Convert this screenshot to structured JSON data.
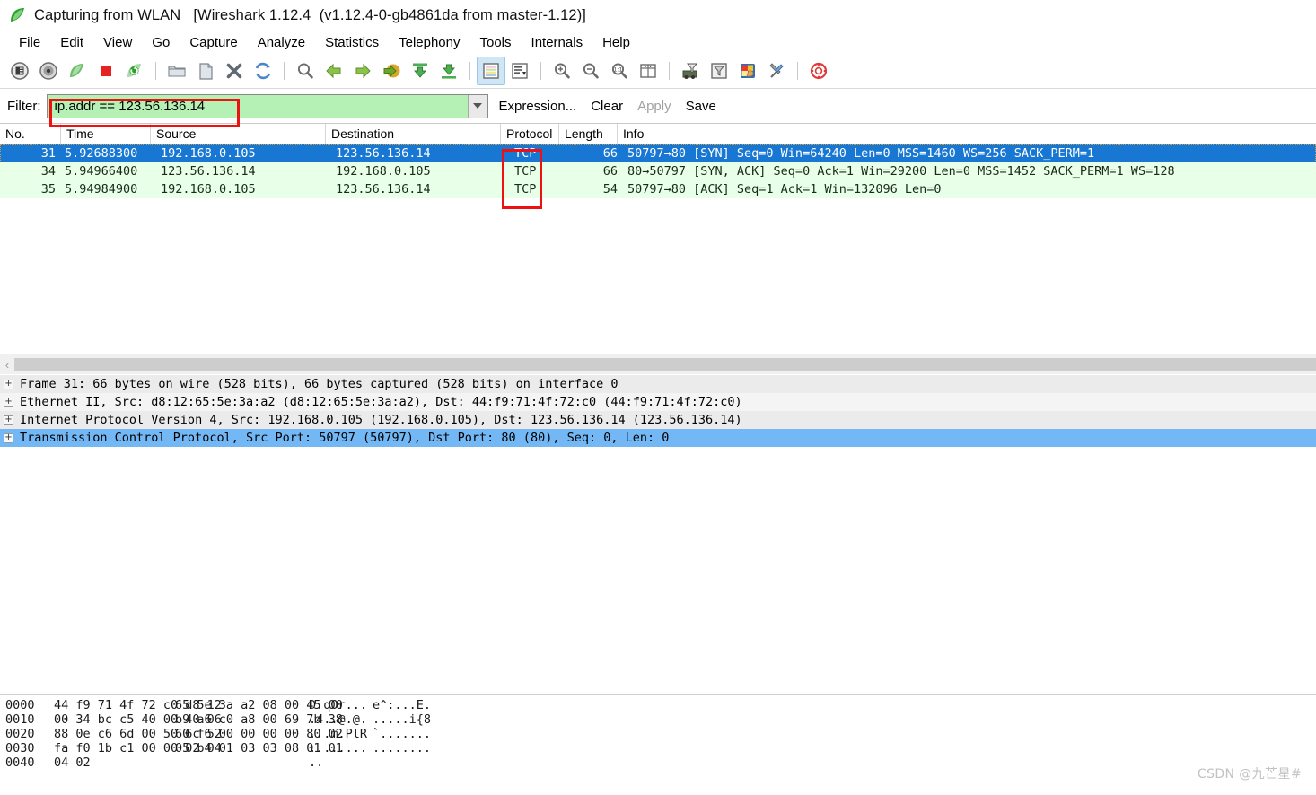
{
  "window": {
    "title": "Capturing from WLAN   [Wireshark 1.12.4  (v1.12.4-0-gb4861da from master-1.12)]",
    "app_icon": "wireshark-fin-icon"
  },
  "menubar": {
    "items": [
      {
        "label": "File",
        "mnemonic": "F"
      },
      {
        "label": "Edit",
        "mnemonic": "E"
      },
      {
        "label": "View",
        "mnemonic": "V"
      },
      {
        "label": "Go",
        "mnemonic": "G"
      },
      {
        "label": "Capture",
        "mnemonic": "C"
      },
      {
        "label": "Analyze",
        "mnemonic": "A"
      },
      {
        "label": "Statistics",
        "mnemonic": "S"
      },
      {
        "label": "Telephony",
        "mnemonic": "y"
      },
      {
        "label": "Tools",
        "mnemonic": "T"
      },
      {
        "label": "Internals",
        "mnemonic": "I"
      },
      {
        "label": "Help",
        "mnemonic": "H"
      }
    ]
  },
  "toolbar": {
    "buttons": [
      {
        "name": "interfaces-icon",
        "group": 0
      },
      {
        "name": "capture-options-icon",
        "group": 0
      },
      {
        "name": "start-capture-icon",
        "group": 0
      },
      {
        "name": "stop-capture-icon",
        "group": 0
      },
      {
        "name": "restart-capture-icon",
        "group": 0
      },
      {
        "name": "open-file-icon",
        "group": 1
      },
      {
        "name": "save-file-icon",
        "group": 1
      },
      {
        "name": "close-file-icon",
        "group": 1
      },
      {
        "name": "reload-file-icon",
        "group": 1
      },
      {
        "name": "find-packet-icon",
        "group": 2
      },
      {
        "name": "go-back-icon",
        "group": 2
      },
      {
        "name": "go-forward-icon",
        "group": 2
      },
      {
        "name": "go-to-packet-icon",
        "group": 2
      },
      {
        "name": "go-first-packet-icon",
        "group": 2
      },
      {
        "name": "go-last-packet-icon",
        "group": 2
      },
      {
        "name": "colorize-packet-list-icon",
        "group": 3,
        "active": true
      },
      {
        "name": "auto-scroll-icon",
        "group": 3
      },
      {
        "name": "zoom-in-icon",
        "group": 4
      },
      {
        "name": "zoom-out-icon",
        "group": 4
      },
      {
        "name": "zoom-reset-icon",
        "group": 4
      },
      {
        "name": "resize-columns-icon",
        "group": 4
      },
      {
        "name": "capture-filters-icon",
        "group": 5
      },
      {
        "name": "display-filters-icon",
        "group": 5
      },
      {
        "name": "coloring-rules-icon",
        "group": 5
      },
      {
        "name": "preferences-icon",
        "group": 5
      },
      {
        "name": "help-contents-icon",
        "group": 6
      }
    ]
  },
  "filterbar": {
    "label": "Filter:",
    "value": "ip.addr == 123.56.136.14",
    "placeholder": "",
    "dropdown_icon": "chevron-down-icon",
    "expression_label": "Expression...",
    "clear_label": "Clear",
    "apply_label": "Apply",
    "apply_disabled": true,
    "save_label": "Save",
    "field_bg": "#b5f0b5",
    "annotation_color": "#ee1111"
  },
  "packet_list": {
    "columns": [
      "No.",
      "Time",
      "Source",
      "Destination",
      "Protocol",
      "Length",
      "Info"
    ],
    "rows": [
      {
        "no": "31",
        "time": "5.92688300",
        "source": "192.168.0.105",
        "destination": "123.56.136.14",
        "protocol": "TCP",
        "length": "66",
        "info": "50797→80 [SYN] Seq=0 Win=64240 Len=0 MSS=1460 WS=256 SACK_PERM=1",
        "selected": true
      },
      {
        "no": "34",
        "time": "5.94966400",
        "source": "123.56.136.14",
        "destination": "192.168.0.105",
        "protocol": "TCP",
        "length": "66",
        "info": "80→50797 [SYN, ACK] Seq=0 Ack=1 Win=29200 Len=0 MSS=1452 SACK_PERM=1 WS=128",
        "selected": false
      },
      {
        "no": "35",
        "time": "5.94984900",
        "source": "192.168.0.105",
        "destination": "123.56.136.14",
        "protocol": "TCP",
        "length": "54",
        "info": "50797→80 [ACK] Seq=1 Ack=1 Win=132096 Len=0",
        "selected": false
      }
    ],
    "selected_bg": "#1877d2",
    "row_bg": "#e8ffe8"
  },
  "packet_details": {
    "rows": [
      {
        "text": "Frame 31: 66 bytes on wire (528 bits), 66 bytes captured (528 bits) on interface 0",
        "expander": "+",
        "selected": false
      },
      {
        "text": "Ethernet II, Src: d8:12:65:5e:3a:a2 (d8:12:65:5e:3a:a2), Dst: 44:f9:71:4f:72:c0 (44:f9:71:4f:72:c0)",
        "expander": "+",
        "selected": false
      },
      {
        "text": "Internet Protocol Version 4, Src: 192.168.0.105 (192.168.0.105), Dst: 123.56.136.14 (123.56.136.14)",
        "expander": "+",
        "selected": false
      },
      {
        "text": "Transmission Control Protocol, Src Port: 50797 (50797), Dst Port: 80 (80), Seq: 0, Len: 0",
        "expander": "+",
        "selected": true
      }
    ],
    "selected_bg": "#73b8f5"
  },
  "hex_pane": {
    "rows": [
      {
        "offset": "0000",
        "bytes1": "44 f9 71 4f 72 c0 d8 12",
        "bytes2": "65 5e 3a a2 08 00 45 00",
        "ascii1": "D.qOr...",
        "ascii2": "e^:...E."
      },
      {
        "offset": "0010",
        "bytes1": "00 34 bc c5 40 00 40 06",
        "bytes2": "b9 a6 c0 a8 00 69 7b 38",
        "ascii1": ".4..@.@.",
        "ascii2": ".....i{8"
      },
      {
        "offset": "0020",
        "bytes1": "88 0e c6 6d 00 50 6c 52",
        "bytes2": "60 f6 00 00 00 00 80 02",
        "ascii1": "...m.PlR",
        "ascii2": "`......."
      },
      {
        "offset": "0030",
        "bytes1": "fa f0 1b c1 00 00 02 04",
        "bytes2": "05 b4 01 03 03 08 01 01",
        "ascii1": "........",
        "ascii2": "........"
      },
      {
        "offset": "0040",
        "bytes1": "04 02",
        "bytes2": "",
        "ascii1": "..",
        "ascii2": ""
      }
    ]
  },
  "scrollbar": {
    "left_arrow_icon": "chevron-left-icon"
  },
  "watermark": {
    "text": "CSDN @九芒星#"
  }
}
